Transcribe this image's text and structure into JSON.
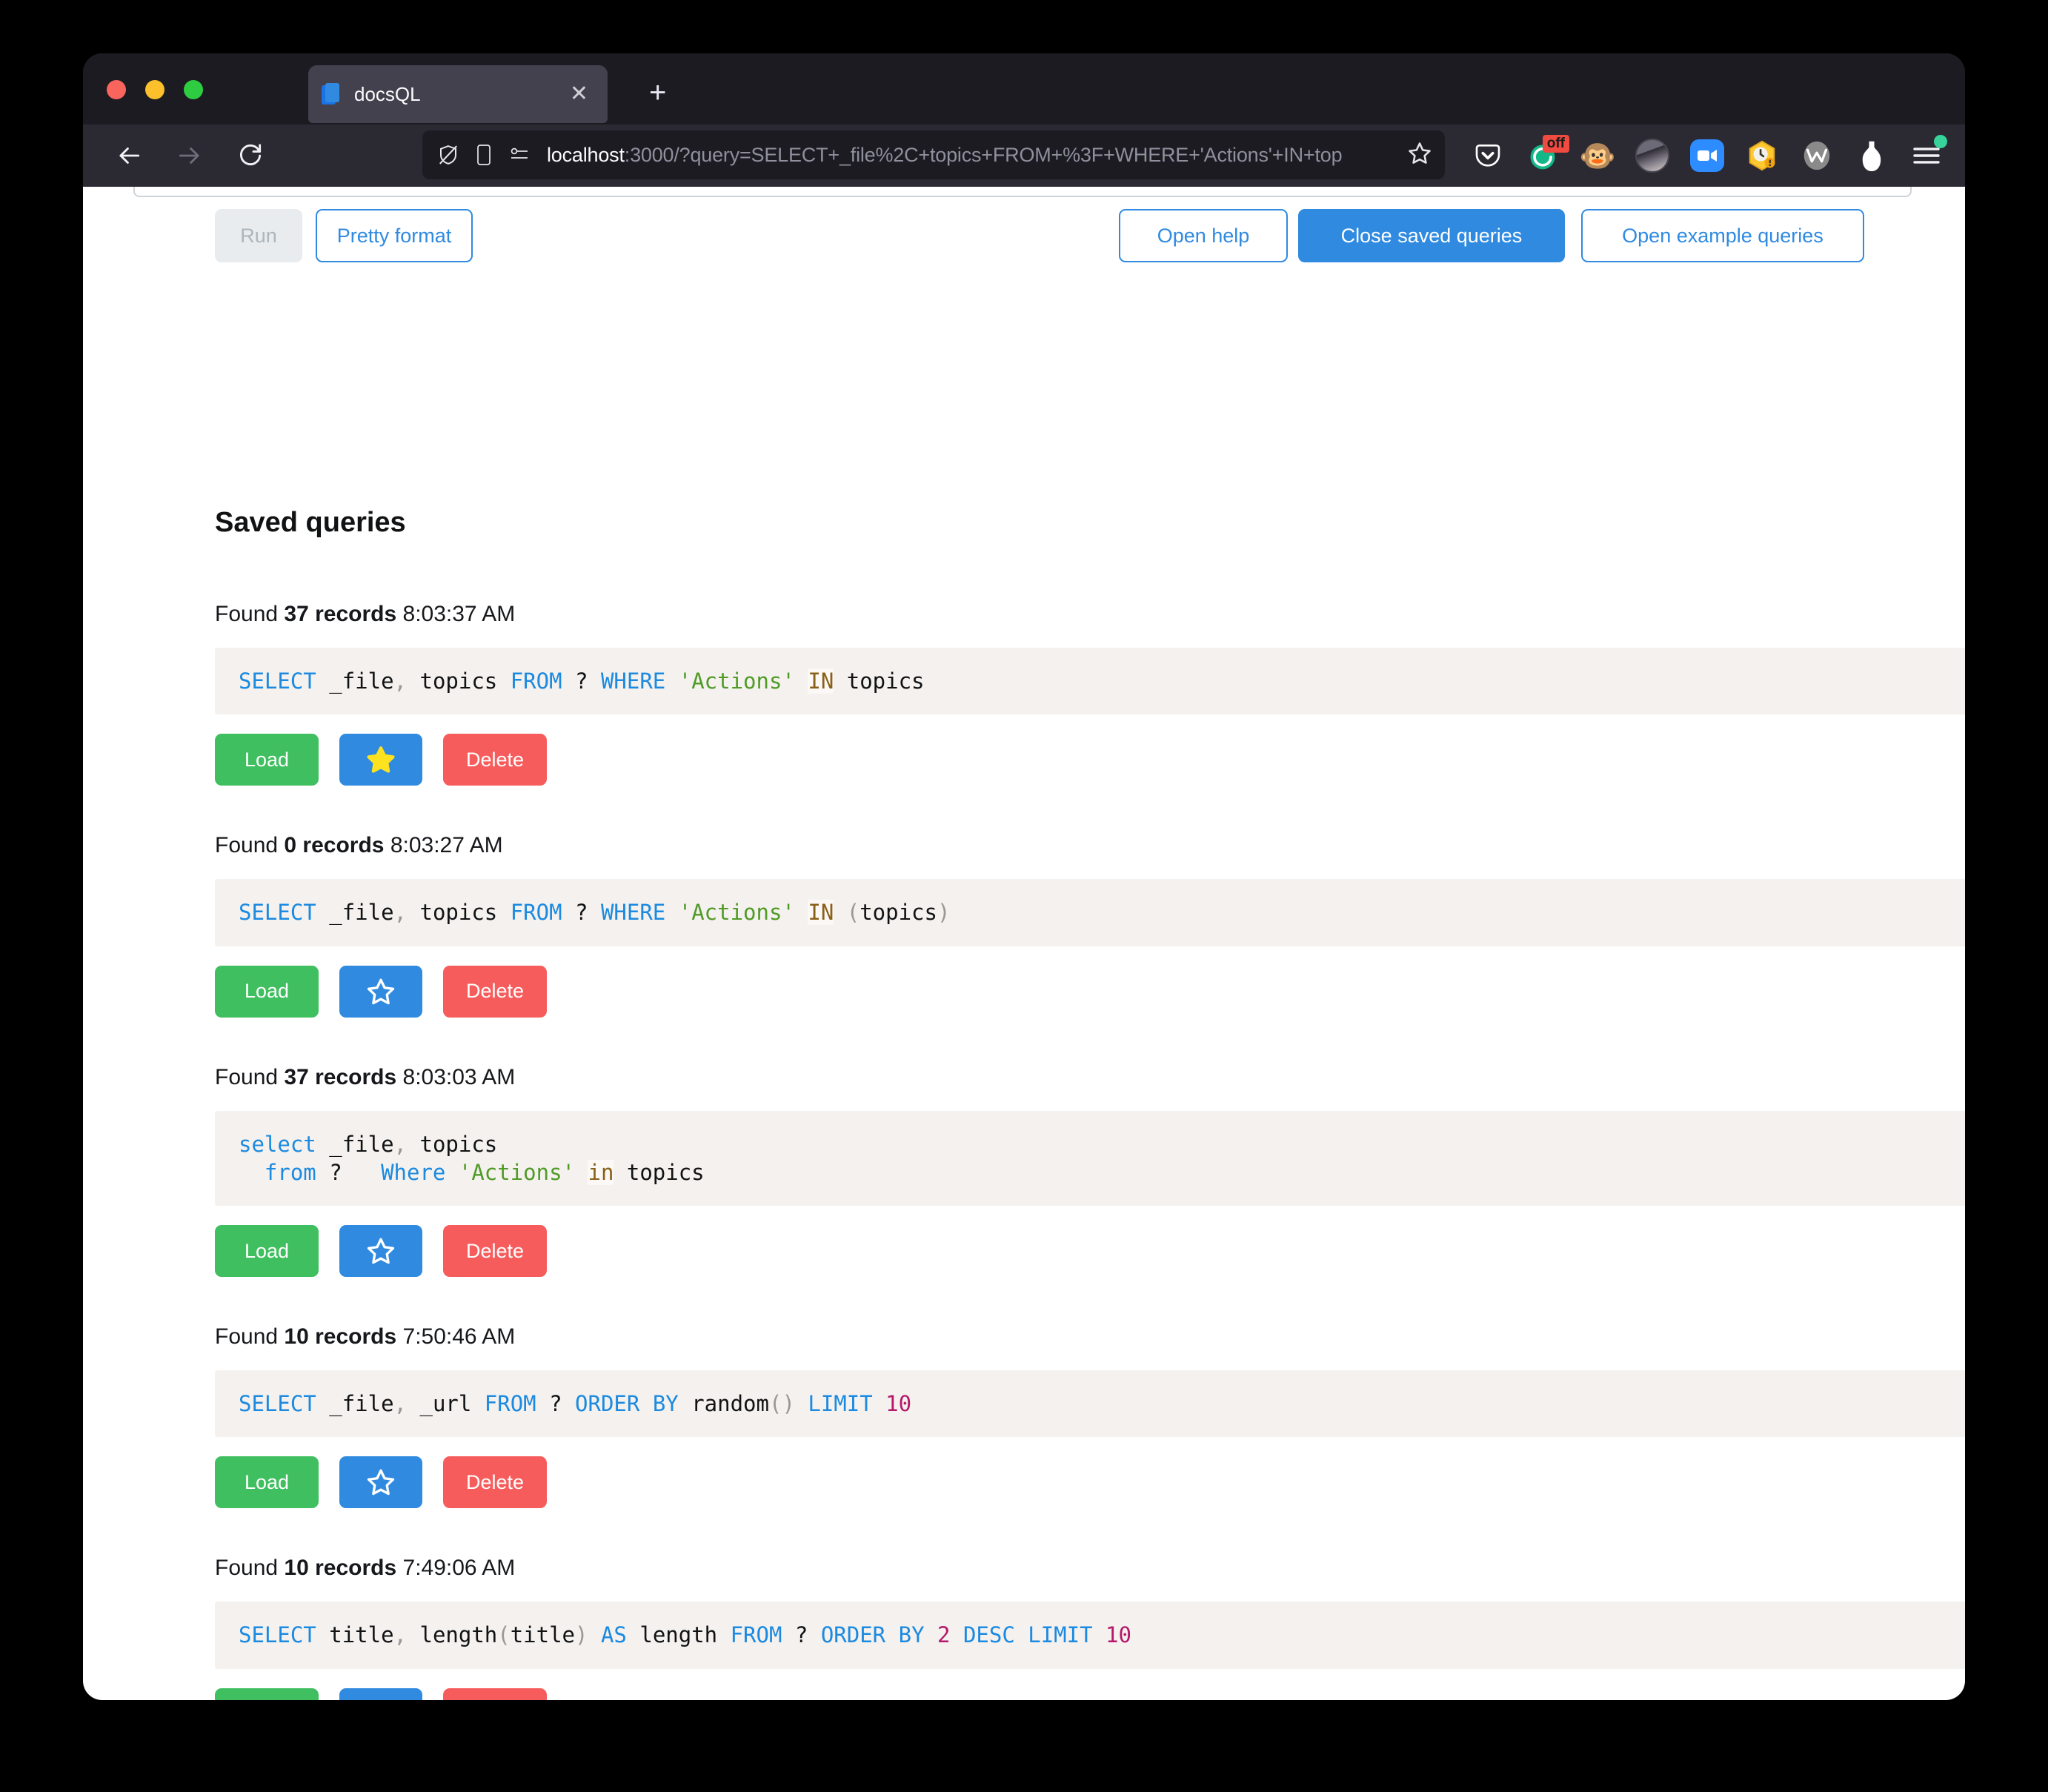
{
  "browser": {
    "traffic_lights": [
      "close-red",
      "minimize-yellow",
      "maximize-green"
    ],
    "tab": {
      "title": "docsQL",
      "favicon": "document-icon",
      "close_label": "✕"
    },
    "new_tab_label": "+",
    "nav": {
      "back_icon": "back-arrow-icon",
      "forward_icon": "forward-arrow-icon",
      "reload_icon": "reload-icon"
    },
    "url": {
      "host": "localhost",
      "path": ":3000/?query=SELECT+_file%2C+topics+FROM+%3F+WHERE+'Actions'+IN+top",
      "shield_icon": "tracking-protection-off-icon",
      "reader_icon": "reader-view-icon",
      "permissions_icon": "site-permissions-icon",
      "bookmark_icon": "bookmark-star-icon"
    },
    "extensions": [
      {
        "name": "pocket-icon",
        "label": ""
      },
      {
        "name": "adblock-off-icon",
        "label": "off"
      },
      {
        "name": "monkey-icon",
        "label": "🐵"
      },
      {
        "name": "profile-avatar-icon",
        "label": ""
      },
      {
        "name": "zoom-icon",
        "label": ""
      },
      {
        "name": "honey-icon",
        "label": ""
      },
      {
        "name": "wallet-w-icon",
        "label": "W"
      },
      {
        "name": "vase-icon",
        "label": ""
      },
      {
        "name": "app-menu-icon",
        "label": ""
      }
    ]
  },
  "toolbar": {
    "run_label": "Run",
    "pretty_format_label": "Pretty format",
    "open_help_label": "Open help",
    "close_saved_queries_label": "Close saved queries",
    "open_example_queries_label": "Open example queries"
  },
  "page": {
    "title": "Saved queries"
  },
  "actions": {
    "load_label": "Load",
    "delete_label": "Delete",
    "star_filled_icon": "star-filled-icon",
    "star_outline_icon": "star-outline-icon"
  },
  "colors": {
    "accent_blue": "#2f8ae0",
    "load_green": "#3fbf5f",
    "delete_red": "#f75c5c",
    "code_background": "#f5f1ee",
    "keyword": "#1b8ae0",
    "string": "#4f9b26",
    "operator": "#8a6019",
    "number": "#b5186b"
  },
  "queries": [
    {
      "found_prefix": "Found ",
      "records": "37 records",
      "time": "8:03:37 AM",
      "starred": true,
      "sql": "SELECT _file, topics FROM ? WHERE 'Actions' IN topics"
    },
    {
      "found_prefix": "Found ",
      "records": "0 records",
      "time": "8:03:27 AM",
      "starred": false,
      "sql": "SELECT _file, topics FROM ? WHERE 'Actions' IN (topics)"
    },
    {
      "found_prefix": "Found ",
      "records": "37 records",
      "time": "8:03:03 AM",
      "starred": false,
      "sql": "select _file, topics\n  from ?   Where 'Actions' in topics"
    },
    {
      "found_prefix": "Found ",
      "records": "10 records",
      "time": "7:50:46 AM",
      "starred": false,
      "sql": "SELECT _file, _url FROM ? ORDER BY random() LIMIT 10"
    },
    {
      "found_prefix": "Found ",
      "records": "10 records",
      "time": "7:49:06 AM",
      "starred": false,
      "sql": "SELECT title, length(title) AS length FROM ? ORDER BY 2 DESC LIMIT 10"
    }
  ]
}
